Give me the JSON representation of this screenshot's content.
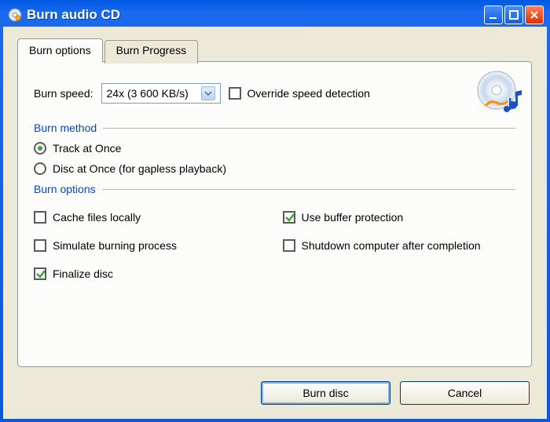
{
  "window": {
    "title": "Burn audio CD"
  },
  "tabs": {
    "options": "Burn options",
    "progress": "Burn Progress"
  },
  "speed": {
    "label": "Burn speed:",
    "value": "24x (3 600 KB/s)",
    "override_label": "Override speed detection",
    "override_checked": false
  },
  "sections": {
    "method": "Burn method",
    "options": "Burn options"
  },
  "method": {
    "track_at_once": "Track at Once",
    "disc_at_once": "Disc at Once (for gapless playback)",
    "selected": "track_at_once"
  },
  "options": {
    "cache": {
      "label": "Cache files locally",
      "checked": false
    },
    "simulate": {
      "label": "Simulate burning process",
      "checked": false
    },
    "finalize": {
      "label": "Finalize disc",
      "checked": true
    },
    "buffer": {
      "label": "Use buffer protection",
      "checked": true
    },
    "shutdown": {
      "label": "Shutdown computer after completion",
      "checked": false
    }
  },
  "buttons": {
    "burn": "Burn disc",
    "cancel": "Cancel"
  }
}
